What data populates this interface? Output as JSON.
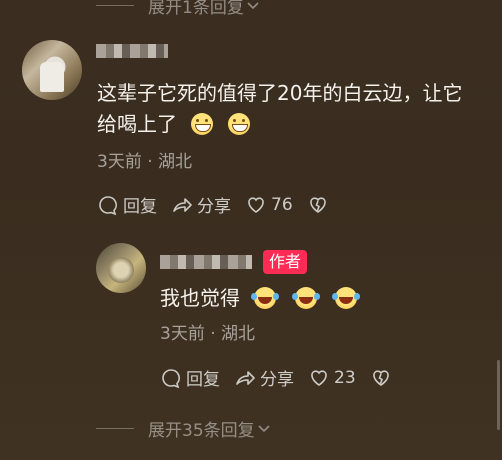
{
  "top_expand": {
    "label": "展开1条回复"
  },
  "comment": {
    "name_snippet": "阿土",
    "text": "这辈子它死的值得了20年的白云边，让它给喝上了",
    "emojis": [
      "grin-emoji",
      "grin-emoji"
    ],
    "meta": "3天前 · 湖北",
    "reply_label": "回复",
    "share_label": "分享",
    "like_count": "76"
  },
  "reply": {
    "author_badge": "作者",
    "text": "我也觉得",
    "emojis": [
      "laugh-cry-emoji",
      "laugh-cry-emoji",
      "laugh-cry-emoji"
    ],
    "meta": "3天前 · 湖北",
    "reply_label": "回复",
    "share_label": "分享",
    "like_count": "23"
  },
  "bottom_expand": {
    "label": "展开35条回复"
  },
  "colors": {
    "badge": "#fe2c55",
    "background": "#3b2e20"
  }
}
